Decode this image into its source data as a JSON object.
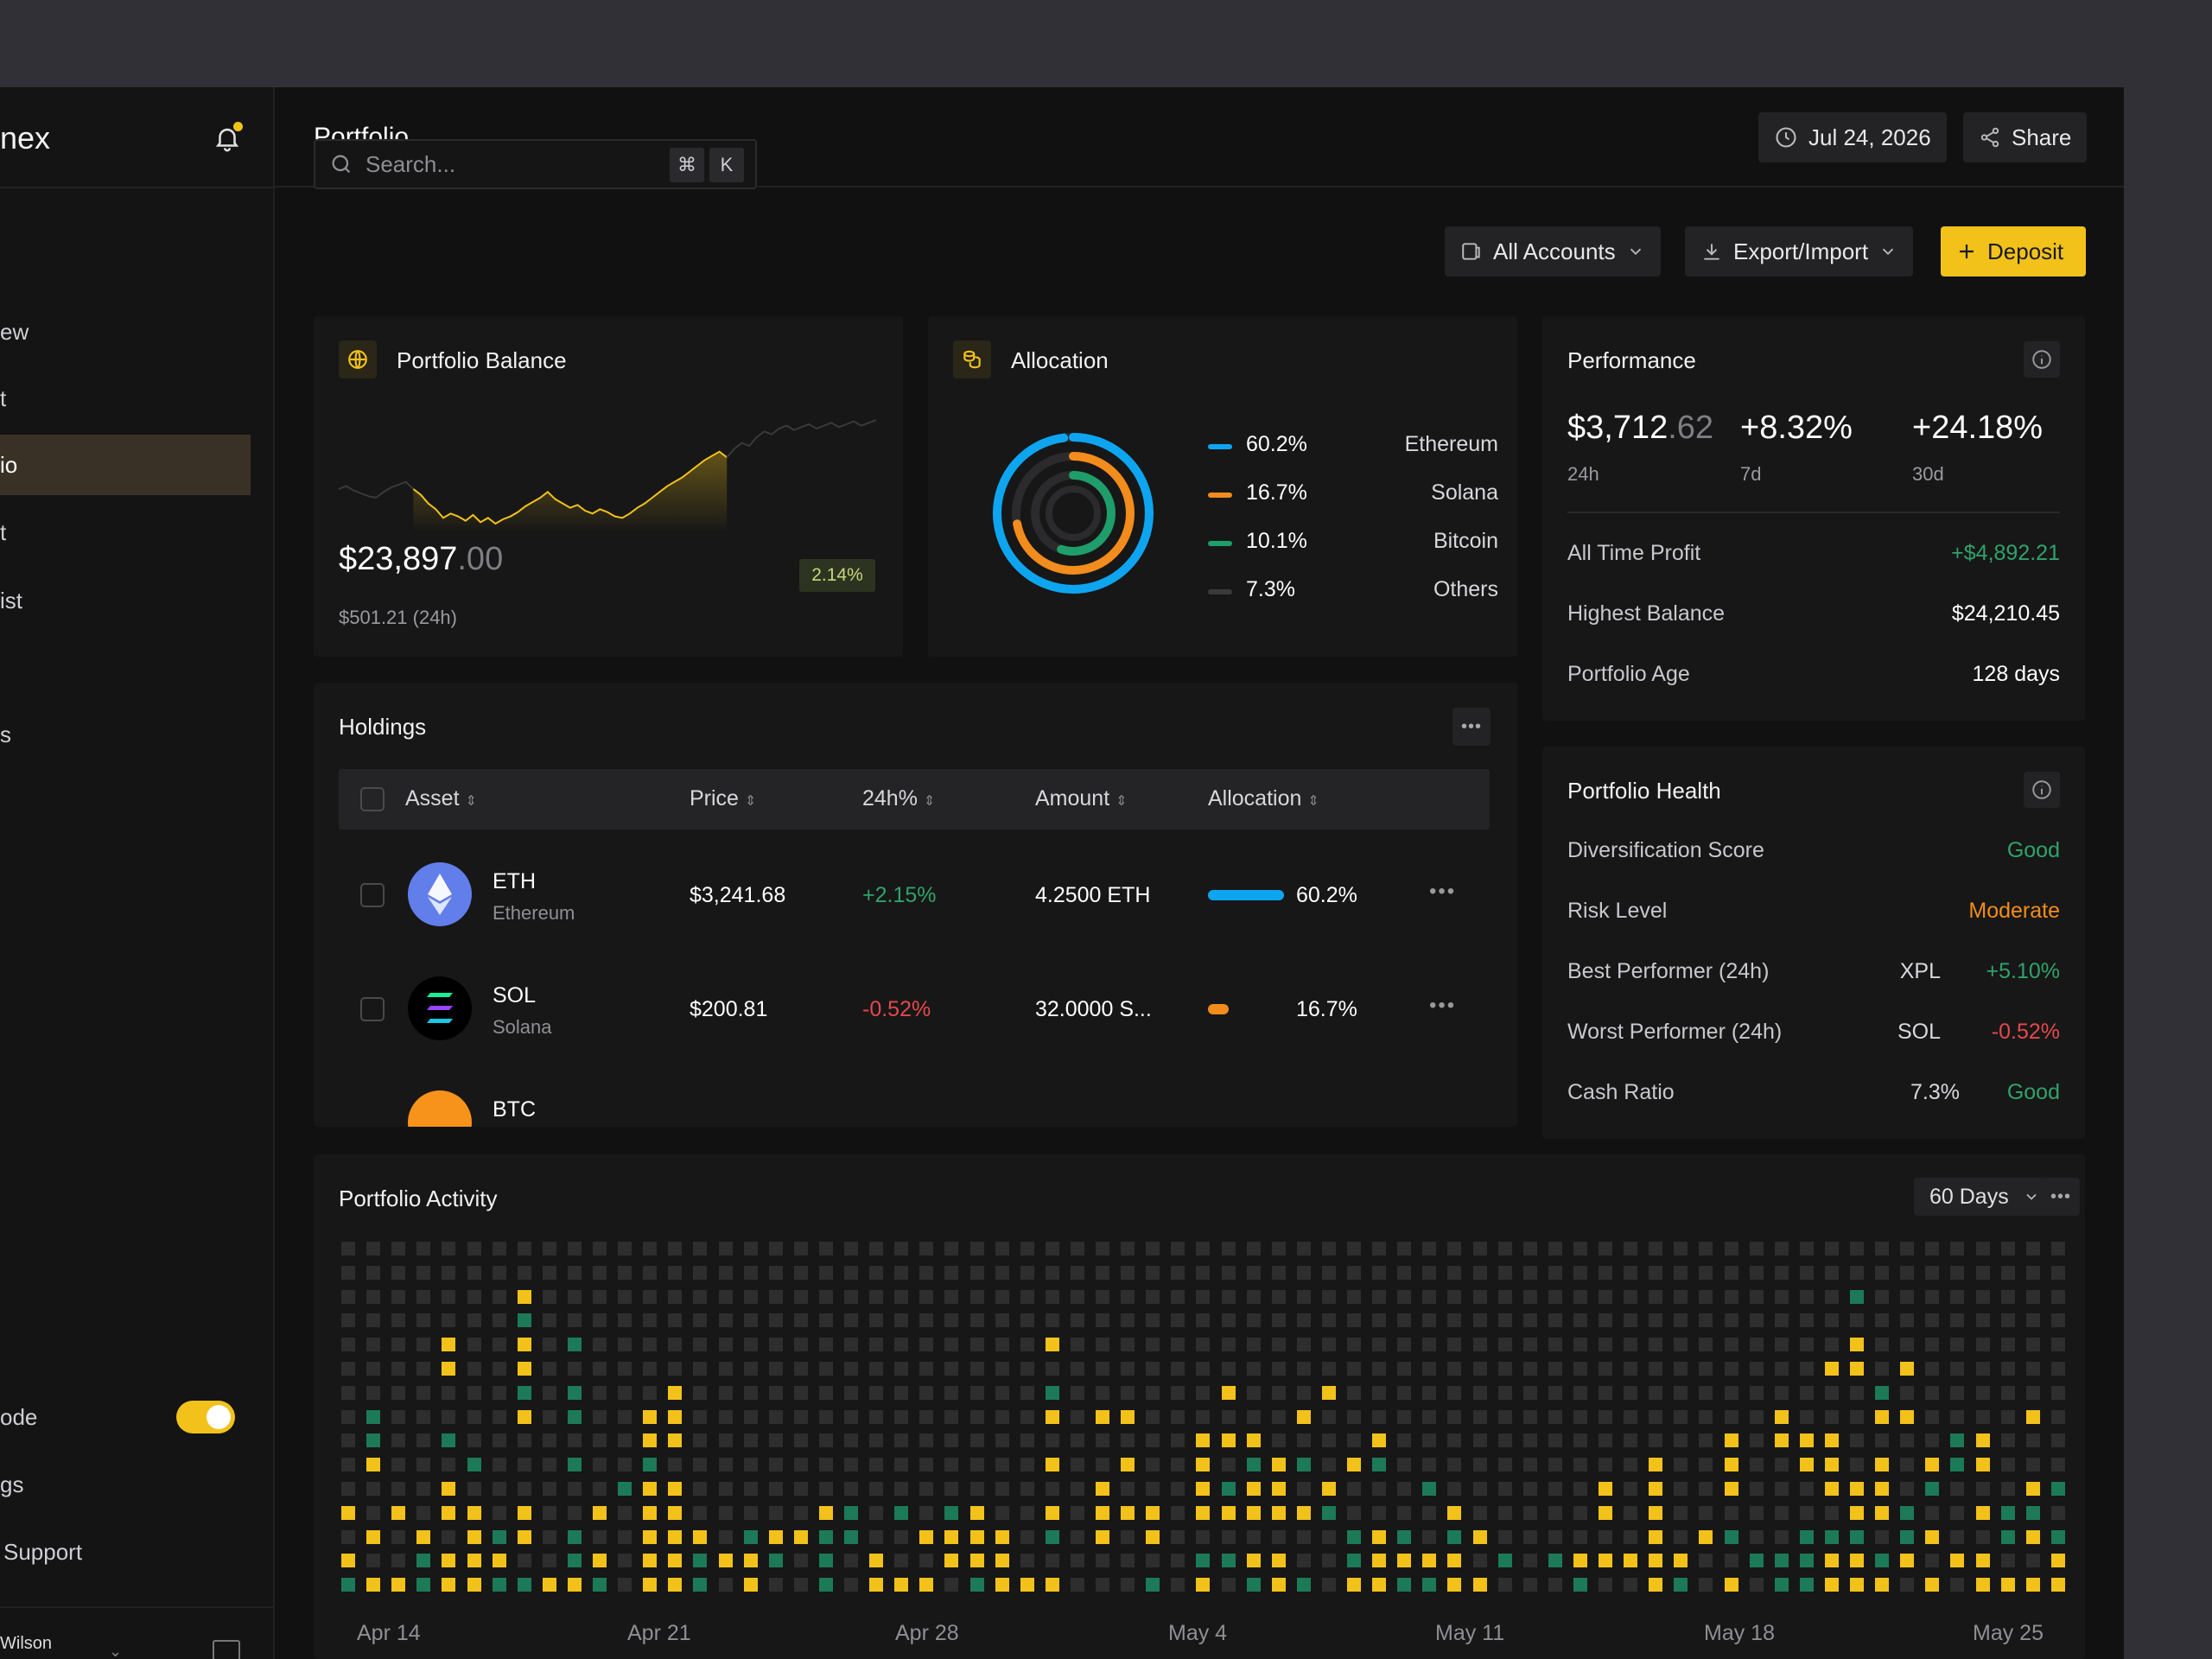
{
  "sidebar": {
    "brand": "nex",
    "nav": [
      "ew",
      "t",
      "io",
      "t",
      "ist",
      "",
      "s"
    ],
    "dark_mode_label": "ode",
    "settings_label": "gs",
    "support_label": "Support",
    "user_name": "Wilson"
  },
  "header": {
    "title": "Portfolio",
    "date": "Jul 24, 2026",
    "share": "Share"
  },
  "toolbar": {
    "search_placeholder": "Search...",
    "kbd_cmd": "⌘",
    "kbd_k": "K",
    "accounts": "All Accounts",
    "export": "Export/Import",
    "deposit": "Deposit"
  },
  "balance": {
    "title": "Portfolio Balance",
    "amount_main": "$23,897",
    "amount_cents": ".00",
    "change_24h": "$501.21 (24h)",
    "change_pct": "2.14%",
    "series": [
      50,
      52,
      49,
      47,
      45,
      44,
      48,
      51,
      53,
      55,
      50,
      46,
      40,
      36,
      30,
      33,
      31,
      28,
      32,
      27,
      30,
      26,
      29,
      31,
      34,
      38,
      41,
      44,
      48,
      43,
      40,
      37,
      39,
      35,
      33,
      36,
      34,
      31,
      30,
      33,
      37,
      40,
      44,
      48,
      52,
      55,
      58,
      62,
      66,
      70,
      73,
      76,
      72,
      78,
      82,
      80,
      86,
      90,
      88,
      92,
      94,
      91,
      93,
      95,
      92,
      94,
      96,
      93,
      95,
      97,
      94,
      96,
      98
    ]
  },
  "allocation": {
    "title": "Allocation",
    "items": [
      {
        "pct": "60.2%",
        "name": "Ethereum",
        "value": 60.2,
        "color": "#0ea5f0"
      },
      {
        "pct": "16.7%",
        "name": "Solana",
        "value": 16.7,
        "color": "#f28c1c"
      },
      {
        "pct": "10.1%",
        "name": "Bitcoin",
        "value": 10.1,
        "color": "#1f9d6a"
      },
      {
        "pct": "7.3%",
        "name": "Others",
        "value": 7.3,
        "color": "#3a3a3c"
      }
    ]
  },
  "performance": {
    "title": "Performance",
    "p24_main": "$3,712",
    "p24_cents": ".62",
    "p24_label": "24h",
    "p7": "+8.32%",
    "p7_label": "7d",
    "p30": "+24.18%",
    "p30_label": "30d",
    "all_time_label": "All Time Profit",
    "all_time": "+$4,892.21",
    "highest_label": "Highest Balance",
    "highest": "$24,210.45",
    "age_label": "Portfolio Age",
    "age": "128 days"
  },
  "health": {
    "title": "Portfolio Health",
    "div_label": "Diversification Score",
    "div_value": "Good",
    "risk_label": "Risk Level",
    "risk_value": "Moderate",
    "best_label": "Best Performer (24h)",
    "best_asset": "XPL",
    "best_value": "+5.10%",
    "worst_label": "Worst Performer (24h)",
    "worst_asset": "SOL",
    "worst_value": "-0.52%",
    "cash_label": "Cash Ratio",
    "cash_pct": "7.3%",
    "cash_value": "Good"
  },
  "holdings": {
    "title": "Holdings",
    "headers": [
      "Asset",
      "Price",
      "24h%",
      "Amount",
      "Allocation"
    ],
    "rows": [
      {
        "symbol": "ETH",
        "name": "Ethereum",
        "price": "$3,241.68",
        "change": "+2.15%",
        "amount": "4.2500 ETH",
        "alloc": "60.2%",
        "alloc_value": 60.2,
        "color": "#0ea5f0"
      },
      {
        "symbol": "SOL",
        "name": "Solana",
        "price": "$200.81",
        "change": "-0.52%",
        "amount": "32.0000 S...",
        "alloc": "16.7%",
        "alloc_value": 16.7,
        "color": "#f28c1c"
      },
      {
        "symbol": "BTC",
        "name": "",
        "price": "",
        "change": "",
        "amount": "",
        "alloc": "",
        "alloc_value": 0,
        "color": "#f7931a"
      }
    ]
  },
  "activity": {
    "title": "Portfolio Activity",
    "range": "60 Days",
    "date_labels": [
      "Apr 14",
      "Apr 21",
      "Apr 28",
      "May 4",
      "May 11",
      "May 18",
      "May 25"
    ],
    "colors": {
      "empty": "#2e2e2e",
      "yellow": "#f2c21a",
      "green": "#1c7a58"
    }
  }
}
